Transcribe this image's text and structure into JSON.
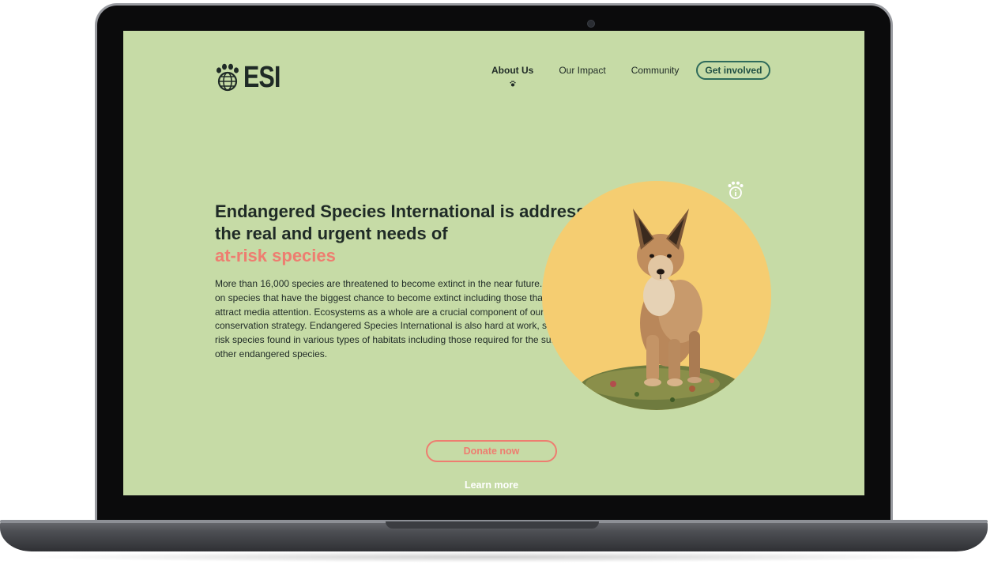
{
  "brand": {
    "logo_text": "ESI"
  },
  "nav": {
    "items": [
      {
        "label": "About Us",
        "active": true
      },
      {
        "label": "Our Impact",
        "active": false
      },
      {
        "label": "Community",
        "active": false
      }
    ],
    "cta_label": "Get involved"
  },
  "hero": {
    "title": "Endangered Species International is addressing the real and urgent needs of",
    "title_accent": "at-risk species",
    "body": "More than 16,000 species are threatened to become extinct in the near future. We focus on species that have the biggest chance to become extinct including those that do not attract media attention. Ecosystems as a whole are a crucial component of our conservation strategy. Endangered Species International is also hard at work, saving at-risk species found in various types of habitats including those required for the survival of other endangered species.",
    "donate_label": "Donate now",
    "learn_more_label": "Learn more"
  },
  "icons": {
    "logo": "paw-globe-icon",
    "active_indicator": "paw-icon",
    "info": "paw-info-icon",
    "hero_image": "wolf-pup-illustration"
  },
  "colors": {
    "page_background": "#c6dba6",
    "text": "#1f2a26",
    "accent": "#ee7d70",
    "cta_border": "#2e6a5b",
    "circle": "#f5cd71"
  }
}
